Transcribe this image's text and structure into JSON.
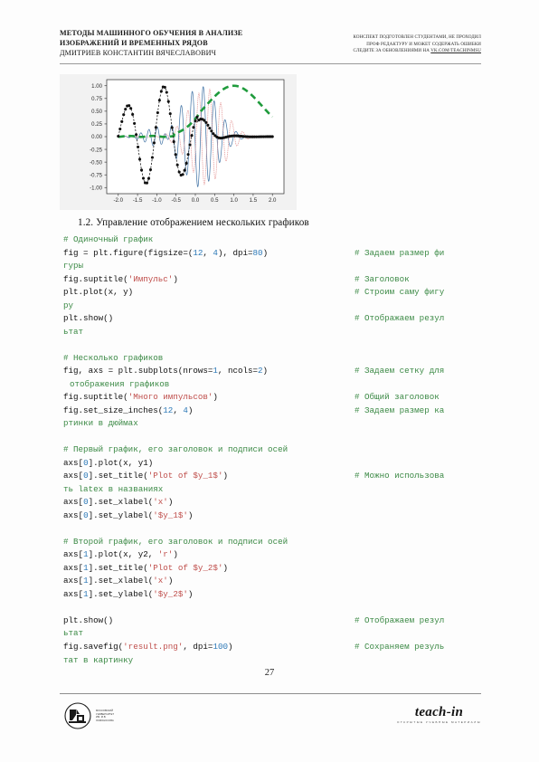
{
  "header": {
    "left_line1": "МЕТОДЫ МАШИННОГО ОБУЧЕНИЯ В АНАЛИЗЕ",
    "left_line2": "ИЗОБРАЖЕНИЙ И ВРЕМЕННЫХ РЯДОВ",
    "left_line3": "ДМИТРИЕВ КОНСТАНТИН ВЯЧЕСЛАВОВИЧ",
    "right_line1": "КОНСПЕКТ ПОДГОТОВЛЕН СТУДЕНТАМИ, НЕ ПРОХОДИЛ",
    "right_line2": "ПРОФ РЕДАКТУРУ И МОЖЕТ СОДЕРЖАТЬ ОШИБКИ",
    "right_line3_prefix": "СЛЕДИТЕ ЗА ОБНОВЛЕНИЯМИ НА ",
    "right_line3_link": "VK.COM/TEACHINMSU"
  },
  "section": {
    "heading": "1.2. Управление отображением нескольких графиков"
  },
  "chart_data": {
    "type": "line",
    "title": "",
    "xlabel": "",
    "ylabel": "",
    "xlim": [
      -2.3,
      2.3
    ],
    "ylim": [
      -1.12,
      1.12
    ],
    "xticks": [
      "-2.0",
      "-1.5",
      "-1.0",
      "-0.5",
      "0.0",
      "0.5",
      "1.0",
      "1.5",
      "2.0"
    ],
    "yticks": [
      "1.00",
      "0.75",
      "0.50",
      "0.25",
      "0.00",
      "-0.25",
      "-0.50",
      "-0.75",
      "-1.00"
    ],
    "grid": false,
    "legend": "none",
    "series": [
      {
        "name": "blue-solid-chirp",
        "color": "#4878a8",
        "style": "solid",
        "description": "high-frequency chirp oscillation centered near x=0.1, amplitude decaying away from center"
      },
      {
        "name": "red-dotted-chirp",
        "color": "#e08a8a",
        "style": "dotted",
        "description": "phase-shifted chirp oscillation, shifted right of the blue series"
      },
      {
        "name": "black-dashed-markers",
        "color": "#101010",
        "style": "dashed-with-circle-markers",
        "description": "slow damped oscillation peaking 0.58 near x=-1.72, trough -0.93 near x=-1.22, peak 0.95 near x=-0.72, decaying to 0 after x=0.6"
      },
      {
        "name": "green-thick-dashed",
        "color": "#1f9b3c",
        "style": "thick-dashed",
        "description": "flat near 0 until x=-0.5, rising smoothly to peak 1.0 at x=1.0, falling to 0.4 at x=2.0"
      }
    ]
  },
  "code": {
    "lines": [
      {
        "kind": "comment",
        "text": "# Одиночный график"
      },
      {
        "kind": "code",
        "segments": [
          {
            "t": "fig = plt.figure(figsize=(",
            "c": "plain"
          },
          {
            "t": "12",
            "c": "num"
          },
          {
            "t": ", ",
            "c": "plain"
          },
          {
            "t": "4",
            "c": "num"
          },
          {
            "t": "), dpi=",
            "c": "plain"
          },
          {
            "t": "80",
            "c": "num"
          },
          {
            "t": ")",
            "c": "plain"
          }
        ],
        "comment": "# Задаем размер фи"
      },
      {
        "kind": "cont",
        "text": "гуры"
      },
      {
        "kind": "code",
        "segments": [
          {
            "t": "fig.suptitle(",
            "c": "plain"
          },
          {
            "t": "'Импульс'",
            "c": "str"
          },
          {
            "t": ")",
            "c": "plain"
          }
        ],
        "comment": "# Заголовок"
      },
      {
        "kind": "code",
        "segments": [
          {
            "t": "plt.plot(x, y)",
            "c": "plain"
          }
        ],
        "comment": "# Строим саму фигу"
      },
      {
        "kind": "cont",
        "text": "ру"
      },
      {
        "kind": "code",
        "segments": [
          {
            "t": "plt.show()",
            "c": "plain"
          }
        ],
        "comment": "# Отображаем резул"
      },
      {
        "kind": "cont",
        "text": "ьтат"
      },
      {
        "kind": "blank"
      },
      {
        "kind": "comment",
        "text": "# Несколько графиков"
      },
      {
        "kind": "code",
        "segments": [
          {
            "t": "fig, axs = plt.subplots(nrows=",
            "c": "plain"
          },
          {
            "t": "1",
            "c": "num"
          },
          {
            "t": ", ncols=",
            "c": "plain"
          },
          {
            "t": "2",
            "c": "num"
          },
          {
            "t": ")",
            "c": "plain"
          }
        ],
        "comment": "# Задаем сетку для"
      },
      {
        "kind": "cont-ind",
        "text": "отображения графиков"
      },
      {
        "kind": "code",
        "segments": [
          {
            "t": "fig.suptitle(",
            "c": "plain"
          },
          {
            "t": "'Много импульсов'",
            "c": "str"
          },
          {
            "t": ")",
            "c": "plain"
          }
        ],
        "comment": "# Общий заголовок"
      },
      {
        "kind": "code",
        "segments": [
          {
            "t": "fig.set_size_inches(",
            "c": "plain"
          },
          {
            "t": "12",
            "c": "num"
          },
          {
            "t": ", ",
            "c": "plain"
          },
          {
            "t": "4",
            "c": "num"
          },
          {
            "t": ")",
            "c": "plain"
          }
        ],
        "comment": "# Задаем размер ка"
      },
      {
        "kind": "cont",
        "text": "ртинки в дюймах"
      },
      {
        "kind": "blank"
      },
      {
        "kind": "comment",
        "text": "# Первый график, его заголовок и подписи осей"
      },
      {
        "kind": "code",
        "segments": [
          {
            "t": "axs[",
            "c": "plain"
          },
          {
            "t": "0",
            "c": "num"
          },
          {
            "t": "].plot(x, y1)",
            "c": "plain"
          }
        ],
        "comment": ""
      },
      {
        "kind": "code",
        "segments": [
          {
            "t": "axs[",
            "c": "plain"
          },
          {
            "t": "0",
            "c": "num"
          },
          {
            "t": "].set_title(",
            "c": "plain"
          },
          {
            "t": "'Plot of $y_1$'",
            "c": "str"
          },
          {
            "t": ")",
            "c": "plain"
          }
        ],
        "comment": "# Можно использова"
      },
      {
        "kind": "cont",
        "text": "ть latex в названиях"
      },
      {
        "kind": "code",
        "segments": [
          {
            "t": "axs[",
            "c": "plain"
          },
          {
            "t": "0",
            "c": "num"
          },
          {
            "t": "].set_xlabel(",
            "c": "plain"
          },
          {
            "t": "'x'",
            "c": "str"
          },
          {
            "t": ")",
            "c": "plain"
          }
        ],
        "comment": ""
      },
      {
        "kind": "code",
        "segments": [
          {
            "t": "axs[",
            "c": "plain"
          },
          {
            "t": "0",
            "c": "num"
          },
          {
            "t": "].set_ylabel(",
            "c": "plain"
          },
          {
            "t": "'$y_1$'",
            "c": "str"
          },
          {
            "t": ")",
            "c": "plain"
          }
        ],
        "comment": ""
      },
      {
        "kind": "blank"
      },
      {
        "kind": "comment",
        "text": "# Второй график, его заголовок и подписи осей"
      },
      {
        "kind": "code",
        "segments": [
          {
            "t": "axs[",
            "c": "plain"
          },
          {
            "t": "1",
            "c": "num"
          },
          {
            "t": "].plot(x, y2, ",
            "c": "plain"
          },
          {
            "t": "'r'",
            "c": "str"
          },
          {
            "t": ")",
            "c": "plain"
          }
        ],
        "comment": ""
      },
      {
        "kind": "code",
        "segments": [
          {
            "t": "axs[",
            "c": "plain"
          },
          {
            "t": "1",
            "c": "num"
          },
          {
            "t": "].set_title(",
            "c": "plain"
          },
          {
            "t": "'Plot of $y_2$'",
            "c": "str"
          },
          {
            "t": ")",
            "c": "plain"
          }
        ],
        "comment": ""
      },
      {
        "kind": "code",
        "segments": [
          {
            "t": "axs[",
            "c": "plain"
          },
          {
            "t": "1",
            "c": "num"
          },
          {
            "t": "].set_xlabel(",
            "c": "plain"
          },
          {
            "t": "'x'",
            "c": "str"
          },
          {
            "t": ")",
            "c": "plain"
          }
        ],
        "comment": ""
      },
      {
        "kind": "code",
        "segments": [
          {
            "t": "axs[",
            "c": "plain"
          },
          {
            "t": "1",
            "c": "num"
          },
          {
            "t": "].set_ylabel(",
            "c": "plain"
          },
          {
            "t": "'$y_2$'",
            "c": "str"
          },
          {
            "t": ")",
            "c": "plain"
          }
        ],
        "comment": ""
      },
      {
        "kind": "blank"
      },
      {
        "kind": "code",
        "segments": [
          {
            "t": "plt.show()",
            "c": "plain"
          }
        ],
        "comment": "# Отображаем резул"
      },
      {
        "kind": "cont",
        "text": "ьтат"
      },
      {
        "kind": "code",
        "segments": [
          {
            "t": "fig.savefig(",
            "c": "plain"
          },
          {
            "t": "'result.png'",
            "c": "str"
          },
          {
            "t": ", dpi=",
            "c": "plain"
          },
          {
            "t": "100",
            "c": "num"
          },
          {
            "t": ")",
            "c": "plain"
          }
        ],
        "comment": "# Сохраняем резуль"
      },
      {
        "kind": "cont",
        "text": "тат в картинку"
      }
    ]
  },
  "footer": {
    "page_number": "27",
    "msu_logo_lines": [
      "МОСКОВСКИЙ",
      "УНИВЕРСИТЕТ",
      "ИМ. М.В.",
      "ЛОМОНОСОВА"
    ],
    "teach_in_word": "teach-in",
    "teach_in_sub": "ОТКРЫТЫЕ УЧЕБНЫЕ МАТЕРИАЛЫ"
  },
  "colors": {
    "comment_green": "#3c8a46",
    "string_red": "#c0504d",
    "number_blue": "#2e7ab8",
    "rule_gray": "#9a9a9a"
  }
}
